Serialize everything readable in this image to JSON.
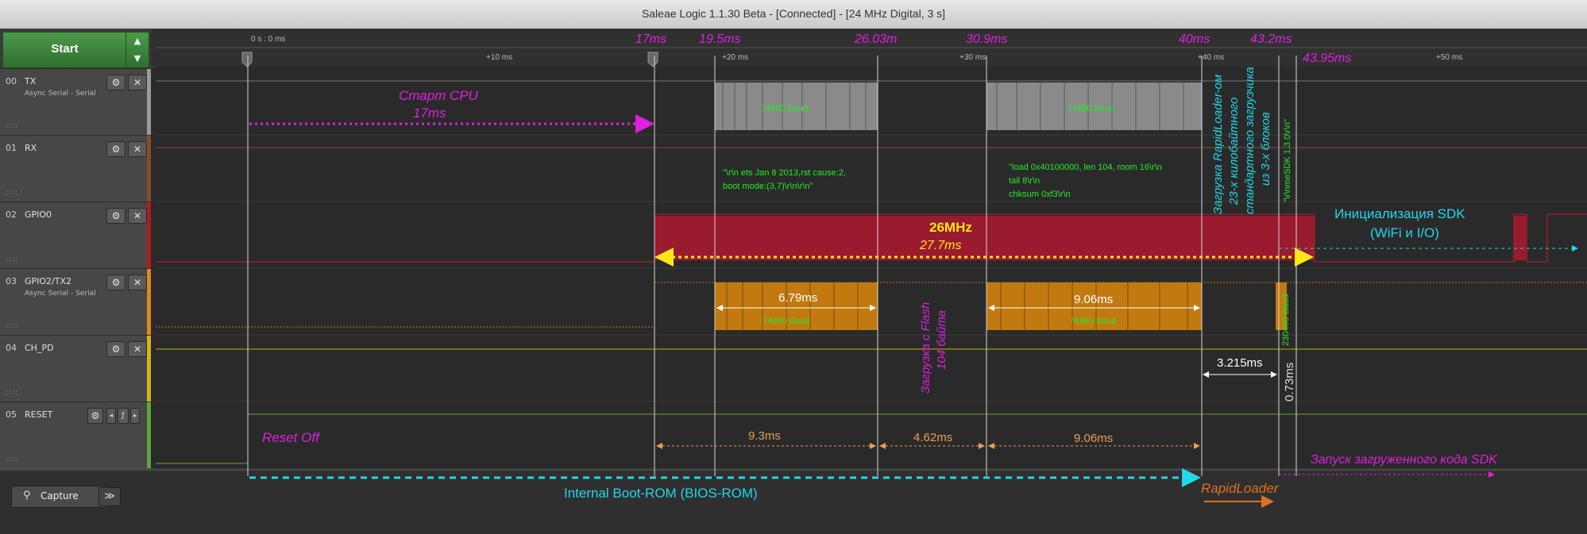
{
  "window": {
    "title": "Saleae Logic 1.1.30 Beta - [Connected] - [24 MHz Digital, 3 s]"
  },
  "start_button": {
    "label": "Start",
    "arrows_up": "▲",
    "arrows_down": "▼"
  },
  "ruler": {
    "origin_label": "0 s : 0 ms",
    "ticks": [
      "+10 ms",
      "+20 ms",
      "+30 ms",
      "+40 ms",
      "+50 ms"
    ]
  },
  "channels": [
    {
      "num": "00",
      "name": "TX",
      "sub": "Async Serial - Serial",
      "color": "#9a9a9a"
    },
    {
      "num": "01",
      "name": "RX",
      "sub": "",
      "color": "#8a4b2a"
    },
    {
      "num": "02",
      "name": "GPIO0",
      "sub": "",
      "color": "#b01c1c"
    },
    {
      "num": "03",
      "name": "GPIO2/TX2",
      "sub": "Async Serial - Serial",
      "color": "#d98a1a"
    },
    {
      "num": "04",
      "name": "CH_PD",
      "sub": "",
      "color": "#d1b51a"
    },
    {
      "num": "05",
      "name": "RESET",
      "sub": "",
      "color": "#5aa83a"
    }
  ],
  "channel_buttons": {
    "gear": "⚙",
    "close": "✕",
    "grip": "::::"
  },
  "annotations": {
    "markers_top": [
      "17ms",
      "19.5ms",
      "26.03m",
      "30.9ms",
      "40ms",
      "43.2ms",
      "43.95ms"
    ],
    "cpu_start": "Старт CPU",
    "cpu_start_time": "17ms",
    "tx_baud_1": "74880 Baud",
    "tx_baud_2": "74880 Baud",
    "rx_text_1_line1": "\"\\r\\n ets Jan  8 2013,rst cause:2,",
    "rx_text_1_line2": "boot mode:(3,7)\\r\\n\\r\\n\"",
    "rx_text_2_line1": "\"load 0x40100000, len 104, room 16\\r\\n",
    "rx_text_2_line2": "tail 8\\r\\n",
    "rx_text_2_line3": "chksum 0xf3\\r\\n",
    "gpio0_freq": "26MHz",
    "gpio0_time": "27.7ms",
    "sdk_init_line1": "Инициализация SDK",
    "sdk_init_line2": "(WiFi и I/O)",
    "tx2_dur_1": "6.79ms",
    "tx2_dur_2": "9.06ms",
    "tx2_baud_1": "74880 Baud",
    "tx2_baud_2": "74880 Baud",
    "tx2_baud_3": "230400 Baud",
    "flash_load_line1": "Загрузка с Flash",
    "flash_load_line2": "104 байта",
    "rapid_loader_line1": "Загрузка RapidLoader-ом",
    "rapid_loader_line2": "23-х килобайтного",
    "rapid_loader_line3": "стандартного загрузчика",
    "rapid_loader_line4": "из 3-х блоков",
    "sdk_string": "\"\\r\\nmeSDK 1.3.0\\r\\n\"",
    "dur_3215": "3.215ms",
    "dur_073": "0.73ms",
    "reset_off": "Reset  Off",
    "dur_93": "9.3ms",
    "dur_462": "4.62ms",
    "dur_906b": "9.06ms",
    "sdk_run": "Запуск загруженного кода SDK",
    "bootrom": "Internal Boot-ROM (BIOS-ROM)",
    "rapidloader": "RapidLoader"
  },
  "bottom": {
    "capture_tab": "Capture",
    "more": "≫"
  },
  "colors": {
    "magenta": "#e020e0",
    "cyan": "#20d8e8",
    "yellow": "#ffe81a",
    "green_text": "#22ee22",
    "dur_white": "#ffffff",
    "orange": "#e8a050",
    "rapid_orange": "#e07020",
    "red_fill": "#9a1a2e",
    "orange_fill": "#c27a10",
    "gray_fill": "#8a8a8a"
  }
}
